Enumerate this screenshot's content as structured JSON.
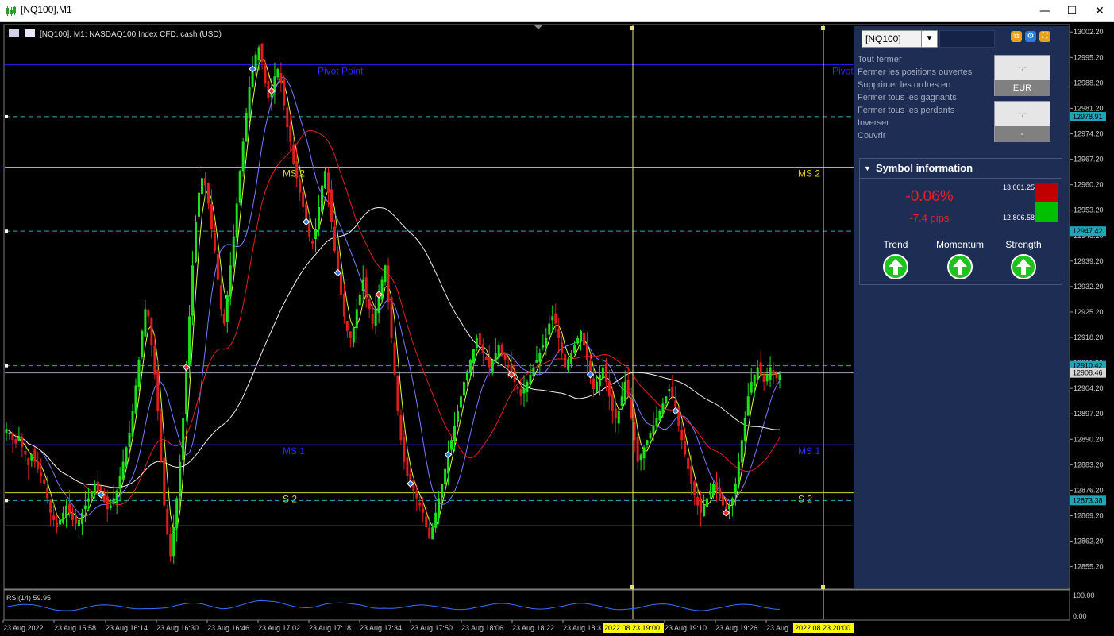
{
  "window": {
    "title": "[NQ100],M1",
    "minimize": "—",
    "maximize": "☐",
    "close": "✕"
  },
  "chart_header": "[NQ100], M1:  NASDAQ100 Index CFD, cash (USD)",
  "rsi_label": "RSI(14) 59.95",
  "rsi_axis": [
    "100.00",
    "0.00"
  ],
  "price_axis": [
    "13002.20",
    "12995.20",
    "12988.20",
    "12981.20",
    "12974.20",
    "12967.20",
    "12960.20",
    "12953.20",
    "12946.20",
    "12939.20",
    "12932.20",
    "12925.20",
    "12918.20",
    "12911.20",
    "12904.20",
    "12897.20",
    "12890.20",
    "12883.20",
    "12876.20",
    "12869.20",
    "12862.20",
    "12855.20"
  ],
  "price_tags": [
    {
      "value": "12978.91",
      "color": "#1fa5b8"
    },
    {
      "value": "12947.42",
      "color": "#1fa5b8"
    },
    {
      "value": "12910.42",
      "color": "#1fa5b8"
    },
    {
      "value": "12908.46",
      "color": "#d8d8d8"
    },
    {
      "value": "12873.38",
      "color": "#1fa5b8"
    }
  ],
  "time_axis": [
    "23 Aug 2022",
    "23 Aug 15:58",
    "23 Aug 16:14",
    "23 Aug 16:30",
    "23 Aug 16:46",
    "23 Aug 17:02",
    "23 Aug 17:18",
    "23 Aug 17:34",
    "23 Aug 17:50",
    "23 Aug 18:06",
    "23 Aug 18:22",
    "23 Aug 18:3",
    "23 Aug 19:10",
    "23 Aug 19:26",
    "23 Aug"
  ],
  "time_highlights": [
    "2022.08.23 19:00",
    "2022.08.23 20:00"
  ],
  "levels": [
    {
      "label": "Pivot Point",
      "price": 12993.2,
      "color": "#2020d0",
      "dash": false,
      "label_color": "#2a2aff"
    },
    {
      "label": "",
      "price": 12978.91,
      "color": "#2aa8b8",
      "dash": true,
      "label_color": ""
    },
    {
      "label": "MS 2",
      "price": 12965.0,
      "color": "#d8d820",
      "dash": false,
      "label_color": "#e0d020"
    },
    {
      "label": "",
      "price": 12947.42,
      "color": "#2aa8b8",
      "dash": true,
      "label_color": ""
    },
    {
      "label": "",
      "price": 12910.42,
      "color": "#2aa8b8",
      "dash": true,
      "label_color": ""
    },
    {
      "label": "",
      "price": 12908.46,
      "color": "#a0a0c0",
      "dash": false,
      "label_color": ""
    },
    {
      "label": "MS 1",
      "price": 12888.7,
      "color": "#2020d0",
      "dash": false,
      "label_color": "#2a2aff"
    },
    {
      "label": "S 2",
      "price": 12875.5,
      "color": "#d8d820",
      "dash": false,
      "label_color": "#e0d020"
    },
    {
      "label": "",
      "price": 12873.38,
      "color": "#2aa8b8",
      "dash": true,
      "label_color": ""
    },
    {
      "label": "",
      "price": 12866.5,
      "color": "#2020d0",
      "dash": false,
      "label_color": ""
    }
  ],
  "panel": {
    "symbol": "[NQ100]",
    "menu": [
      "Tout fermer",
      "Fermer les positions ouvertes",
      "Supprimer les ordres en",
      "Fermer tous les gagnants",
      "Fermer tous les perdants",
      "Inverser",
      "Couvrir"
    ],
    "box1": {
      "value": "-,-",
      "unit": "EUR"
    },
    "box2": {
      "value": "-,-",
      "unit": "-"
    },
    "info_title": "Symbol information",
    "change_pct": "-0.06%",
    "change_pips": "-7.4 pips",
    "high": "13,001.25",
    "low": "12,806.58",
    "indicators": [
      "Trend",
      "Momentum",
      "Strength"
    ],
    "colors": {
      "panel_bg": "#1d2d53",
      "down": "#e62222",
      "up": "#1fc21f"
    }
  },
  "chart_data": {
    "type": "candlestick",
    "symbol": "[NQ100]",
    "timeframe": "M1",
    "y_range": [
      12849,
      13004
    ],
    "close_series": [
      12893,
      12892,
      12890,
      12889,
      12891,
      12888,
      12886,
      12883,
      12886,
      12884,
      12882,
      12880,
      12878,
      12874,
      12870,
      12868,
      12866,
      12868,
      12870,
      12872,
      12870,
      12868,
      12867,
      12868,
      12870,
      12872,
      12874,
      12876,
      12878,
      12876,
      12875,
      12873,
      12871,
      12872,
      12874,
      12876,
      12880,
      12884,
      12888,
      12892,
      12898,
      12905,
      12912,
      12920,
      12926,
      12924,
      12916,
      12908,
      12898,
      12884,
      12872,
      12864,
      12858,
      12866,
      12874,
      12884,
      12896,
      12910,
      12924,
      12938,
      12950,
      12958,
      12962,
      12960,
      12955,
      12948,
      12942,
      12934,
      12926,
      12922,
      12930,
      12938,
      12946,
      12955,
      12964,
      12972,
      12980,
      12987,
      12992,
      12996,
      12998,
      12994,
      12988,
      12984,
      12986,
      12990,
      12992,
      12988,
      12982,
      12976,
      12972,
      12966,
      12962,
      12958,
      12954,
      12950,
      12946,
      12944,
      12948,
      12954,
      12960,
      12964,
      12958,
      12950,
      12942,
      12936,
      12930,
      12924,
      12920,
      12918,
      12921,
      12926,
      12930,
      12934,
      12930,
      12926,
      12922,
      12926,
      12930,
      12934,
      12938,
      12928,
      12918,
      12908,
      12898,
      12890,
      12884,
      12880,
      12878,
      12876,
      12874,
      12872,
      12870,
      12866,
      12863,
      12866,
      12870,
      12874,
      12878,
      12882,
      12886,
      12890,
      12894,
      12898,
      12902,
      12906,
      12909,
      12912,
      12915,
      12918,
      12916,
      12914,
      12912,
      12910,
      12912,
      12914,
      12916,
      12914,
      12912,
      12910,
      12908,
      12906,
      12904,
      12902,
      12904,
      12906,
      12908,
      12910,
      12912,
      12914,
      12916,
      12918,
      12922,
      12924,
      12922,
      12918,
      12914,
      12910,
      12912,
      12914,
      12916,
      12918,
      12920,
      12916,
      12912,
      12908,
      12904,
      12906,
      12908,
      12910,
      12906,
      12902,
      12898,
      12896,
      12898,
      12902,
      12906,
      12902,
      12896,
      12890,
      12884,
      12886,
      12888,
      12890,
      12892,
      12894,
      12896,
      12898,
      12900,
      12902,
      12904,
      12902,
      12898,
      12894,
      12890,
      12886,
      12882,
      12878,
      12875,
      12872,
      12870,
      12872,
      12874,
      12876,
      12878,
      12876,
      12874,
      12872,
      12870,
      12872,
      12874,
      12878,
      12884,
      12890,
      12896,
      12902,
      12906,
      12908,
      12910,
      12908,
      12906,
      12908,
      12910,
      12908,
      12907,
      12908
    ]
  }
}
